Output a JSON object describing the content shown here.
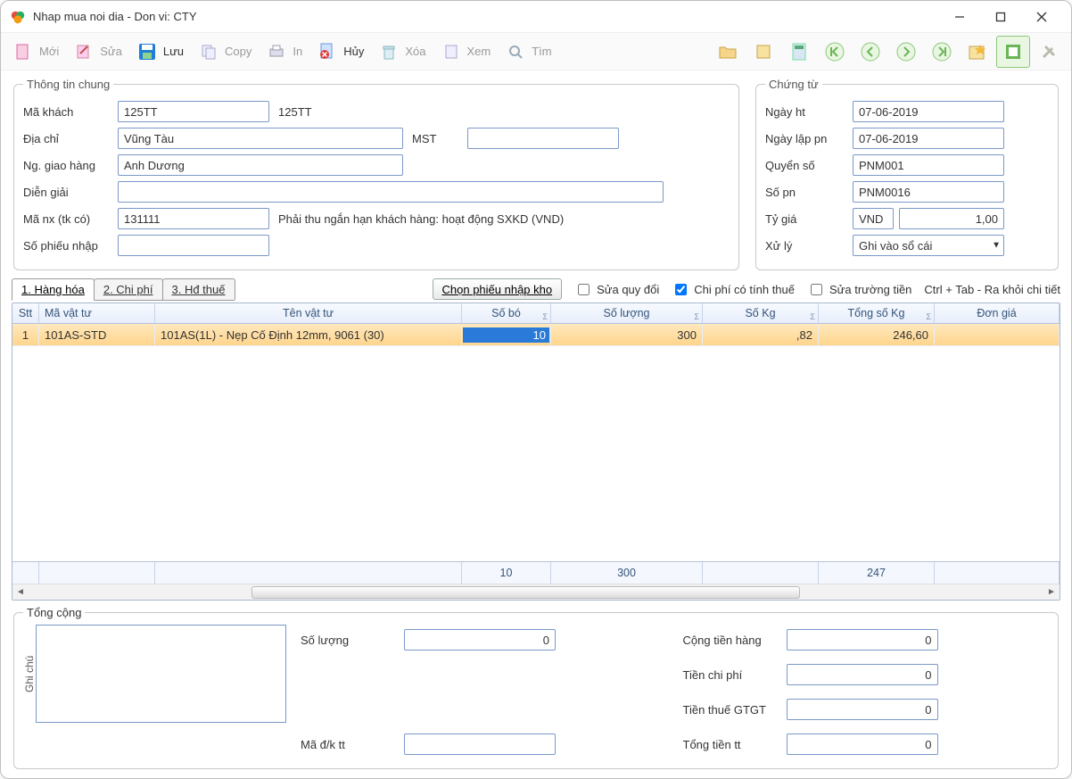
{
  "window": {
    "title": "Nhap mua noi dia - Don vi: CTY"
  },
  "toolbar": {
    "new": "Mới",
    "edit": "Sửa",
    "save": "Lưu",
    "copy": "Copy",
    "print": "In",
    "cancel": "Hủy",
    "delete": "Xóa",
    "view": "Xem",
    "find": "Tìm"
  },
  "general": {
    "legend": "Thông tin chung",
    "customer_code_label": "Mã khách",
    "customer_code": "125TT",
    "customer_code_display": "125TT",
    "address_label": "Địa chỉ",
    "address": "Vũng Tàu",
    "mst_label": "MST",
    "mst": "",
    "deliverer_label": "Ng. giao hàng",
    "deliverer": "Anh Dương",
    "description_label": "Diễn giải",
    "description": "",
    "manx_label": "Mã nx (tk có)",
    "manx": "131111",
    "manx_text": "Phải thu ngắn hạn khách hàng: hoạt động SXKD (VND)",
    "receipt_no_label": "Số phiếu nhập",
    "receipt_no": ""
  },
  "voucher": {
    "legend": "Chứng từ",
    "ngayht_label": "Ngày ht",
    "ngayht": "07-06-2019",
    "ngaylap_label": "Ngày lập pn",
    "ngaylap": "07-06-2019",
    "quyenso_label": "Quyển số",
    "quyenso": "PNM001",
    "sopn_label": "Số pn",
    "sopn": "PNM0016",
    "tygia_label": "Tỷ giá",
    "currency": "VND",
    "tygia": "1,00",
    "xuly_label": "Xử lý",
    "xuly": "Ghi vào sổ cái"
  },
  "tabs": {
    "t1": "1. Hàng hóa",
    "t2": "2. Chi phí",
    "t3": "3. Hđ thuế"
  },
  "grid_bar": {
    "choose_btn": "Chọn phiếu nhập kho",
    "chk1": "Sửa quy đổi",
    "chk2": "Chi phí có tính thuế",
    "chk3": "Sửa trường tiền",
    "hint": "Ctrl + Tab - Ra khỏi chi tiết"
  },
  "grid": {
    "cols": {
      "stt": "Stt",
      "mavt": "Mã vật tư",
      "ten": "Tên vật tư",
      "sobo": "Số bó",
      "soluong": "Số lượng",
      "sokg": "Số Kg",
      "tongkg": "Tổng số Kg",
      "dongia": "Đơn giá"
    },
    "row": {
      "stt": "1",
      "mavt": "101AS-STD",
      "ten": "101AS(1L) - Nẹp Cố Định 12mm, 9061 (30)",
      "sobo": "10",
      "soluong": "300",
      "sokg": ",82",
      "tongkg": "246,60"
    },
    "footer": {
      "sobo": "10",
      "soluong": "300",
      "tongkg": "247"
    }
  },
  "totals": {
    "legend": "Tổng cộng",
    "ghichu_label": "Ghi chú",
    "ghichu": "",
    "soluong_label": "Số lượng",
    "soluong": "0",
    "madk_label": "Mã đ/k tt",
    "madk": "",
    "congtien_label": "Cộng tiền hàng",
    "congtien": "0",
    "chiphi_label": "Tiền chi phí",
    "chiphi": "0",
    "thue_label": "Tiền thuế GTGT",
    "thue": "0",
    "tongtien_label": "Tổng tiền tt",
    "tongtien": "0"
  }
}
